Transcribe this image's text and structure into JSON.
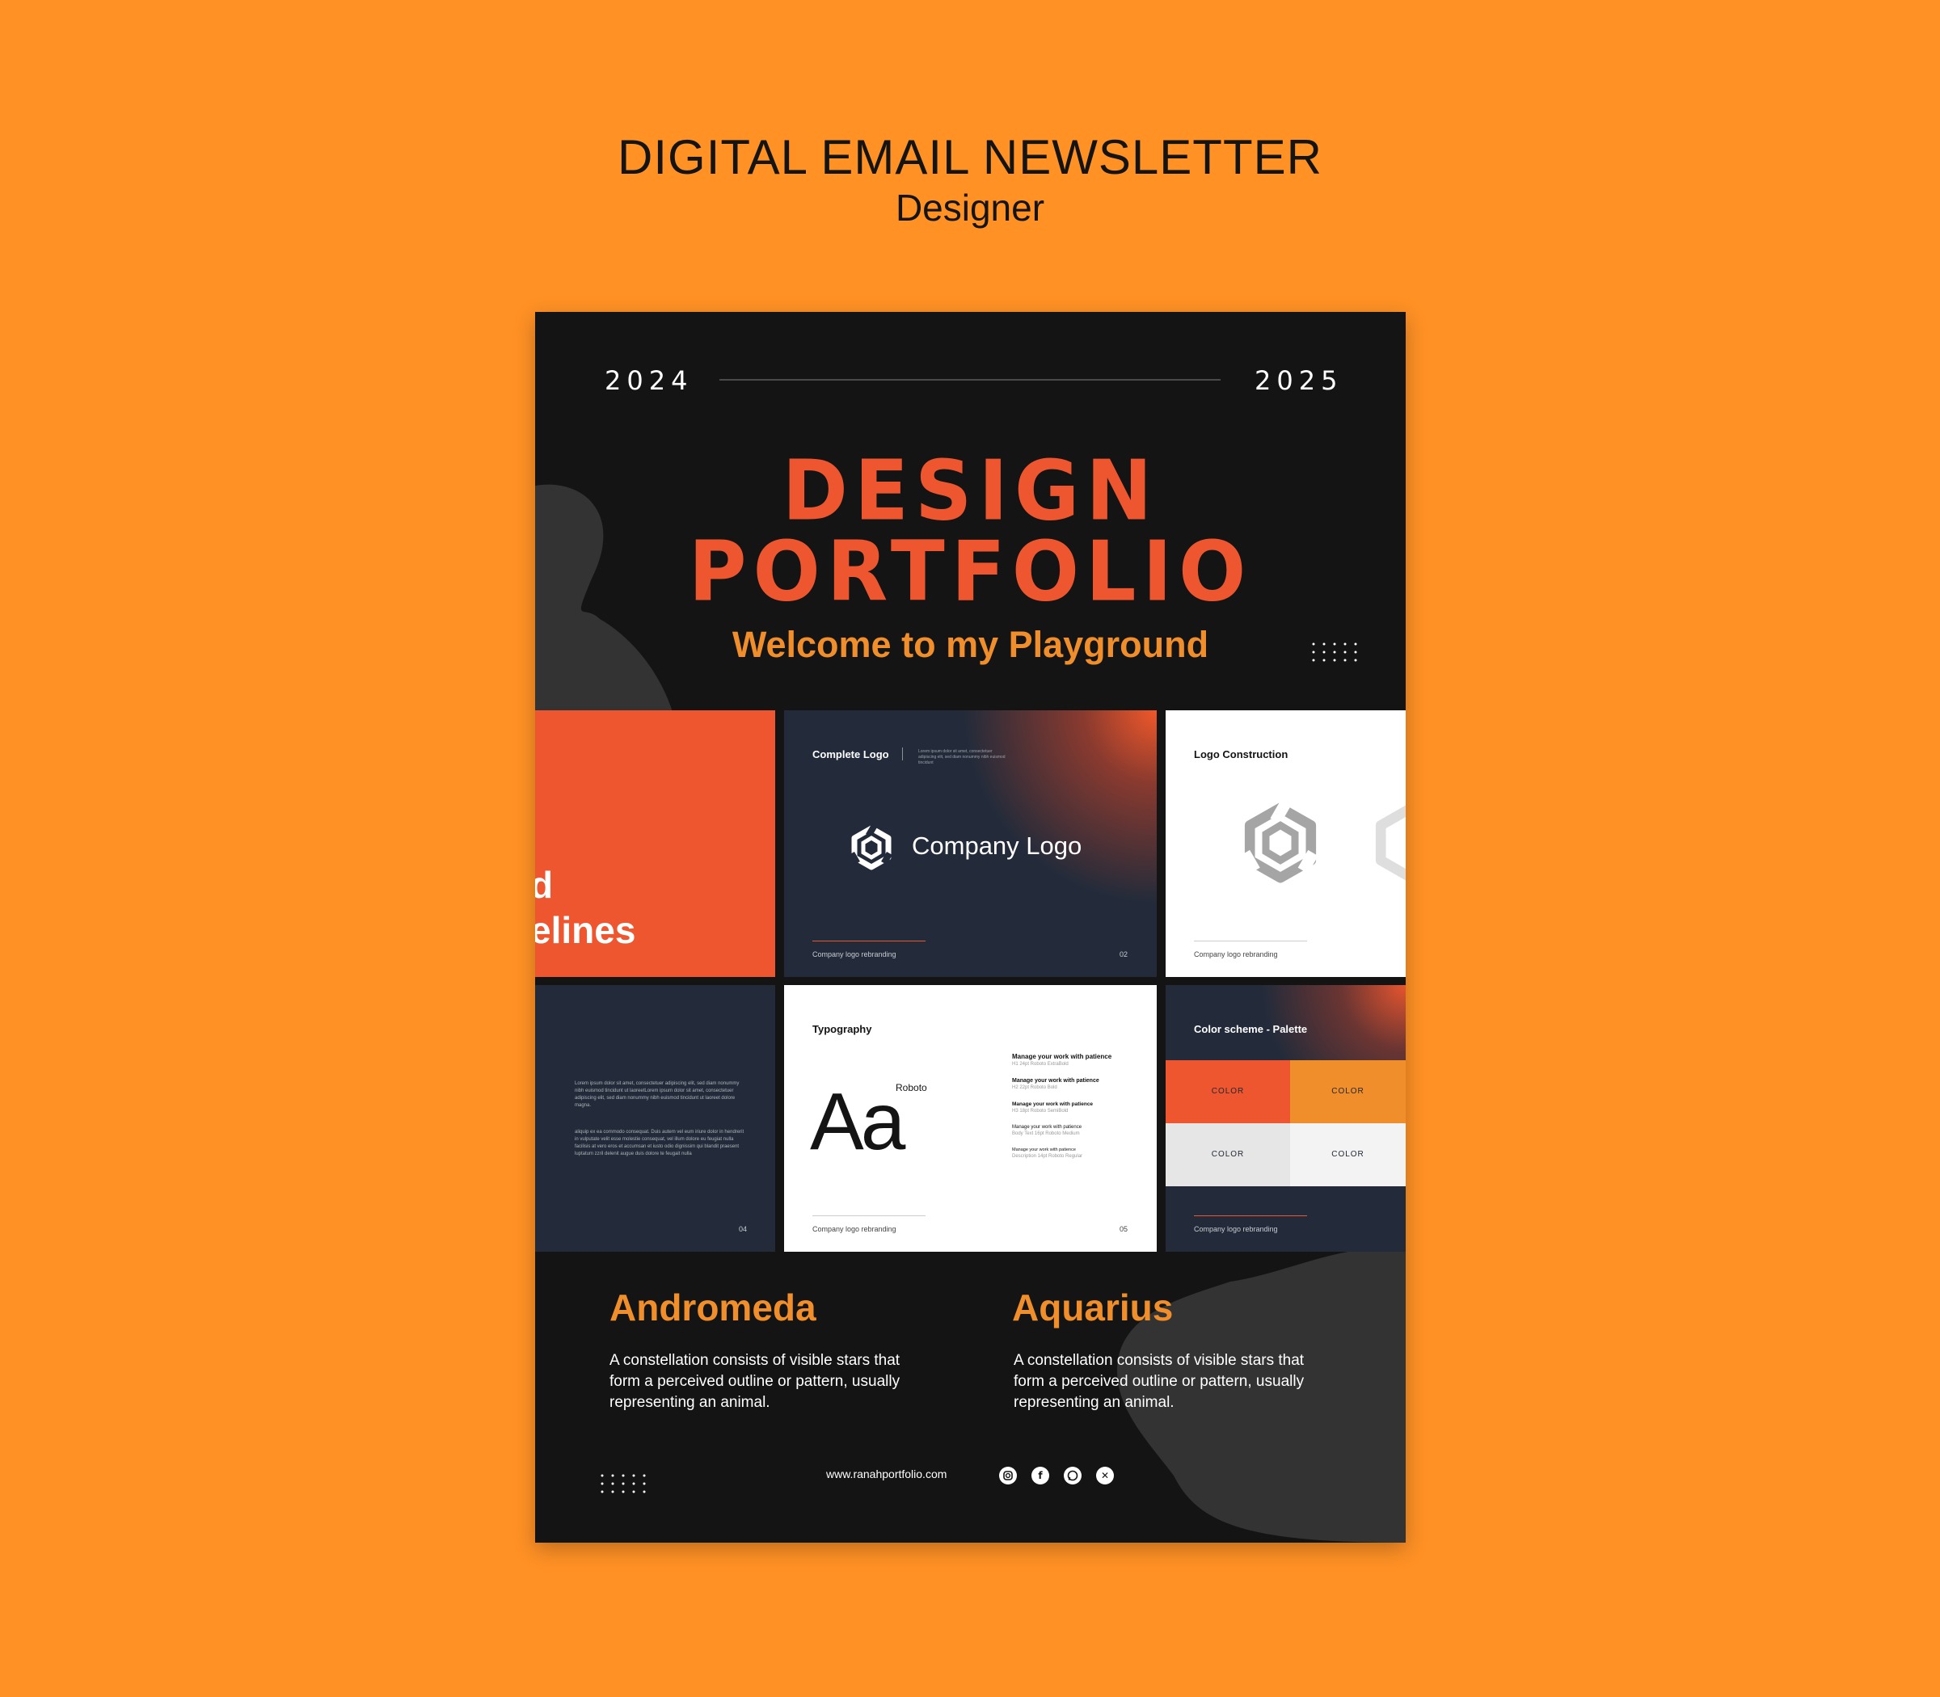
{
  "header": {
    "title": "DIGITAL EMAIL NEWSLETTER",
    "subtitle": "Designer"
  },
  "poster": {
    "year_start": "2024",
    "year_end": "2025",
    "title_line1": "DESIGN",
    "title_line2": "PORTFOLIO",
    "welcome": "Welcome to my Playground",
    "colors": {
      "background": "#141414",
      "accent_red": "#EE5630",
      "accent_orange": "#F08E2B",
      "navy": "#232B3A"
    }
  },
  "cards": {
    "guidelines": {
      "text_line1": "d",
      "text_line2": "elines"
    },
    "complete_logo": {
      "label": "Complete Logo",
      "description": "Lorem ipsum dolor sit amet, consectetuer adipiscing elit, sed diam nonummy nibh euismod tincidunt",
      "logo_text": "Company Logo",
      "footer": "Company logo rebranding",
      "page": "02"
    },
    "logo_construction": {
      "label": "Logo Construction",
      "footer": "Company logo rebranding"
    },
    "text_page": {
      "paragraph1": "Lorem ipsum dolor sit amet, consectetuer adipiscing elit, sed diam nonummy nibh euismod tincidunt ut laoreetLorem ipsum dolor sit amet, consectetuer adipiscing elit, sed diam nonummy nibh euismod tincidunt ut laoreet dolore magna.",
      "paragraph2": "aliquip ex ea commodo consequat. Duis autem vel eum iriure dolor in hendrerit in vulputate velit esse molestie consequat, vel illum dolore eu feugiat nulla facilisis at vero eros et accumsan et iusto odio dignissim qui blandit praesent luptatum zzril delenit augue duis dolore te feugait nulla",
      "page": "04"
    },
    "typography": {
      "label": "Typography",
      "font_name": "Roboto",
      "sample": "Aa",
      "rows": [
        {
          "text": "Manage your work with patience",
          "spec": "H1   24pt   Roboto ExtraBold"
        },
        {
          "text": "Manage your work with patience",
          "spec": "H2   22pt   Roboto Bold"
        },
        {
          "text": "Manage your work with patience",
          "spec": "H3   18pt   Roboto SemiBold"
        },
        {
          "text": "Manage your work with patience",
          "spec": "Body Text   16pt   Roboto Medium"
        },
        {
          "text": "Manage your work with patience",
          "spec": "Description   14pt   Roboto Regular"
        }
      ],
      "footer": "Company logo rebranding",
      "page": "05"
    },
    "color_scheme": {
      "label": "Color scheme - Palette",
      "swatches": [
        {
          "label": "COLOR",
          "color": "#EE5630"
        },
        {
          "label": "COLOR",
          "color": "#F08E2B"
        },
        {
          "label": "COLOR",
          "color": "#E6E6E6"
        },
        {
          "label": "COLOR",
          "color": "#F3F3F3"
        }
      ],
      "footer": "Company logo rebranding"
    }
  },
  "sections": [
    {
      "title": "Andromeda",
      "body": "A constellation consists of visible stars that form a perceived outline or pattern, usually representing an animal."
    },
    {
      "title": "Aquarius",
      "body": "A constellation consists of visible stars that form a perceived outline or pattern, usually representing an animal."
    }
  ],
  "footer": {
    "website": "www.ranahportfolio.com",
    "social_icons": [
      "instagram-icon",
      "facebook-icon",
      "whatsapp-icon",
      "x-icon"
    ]
  }
}
